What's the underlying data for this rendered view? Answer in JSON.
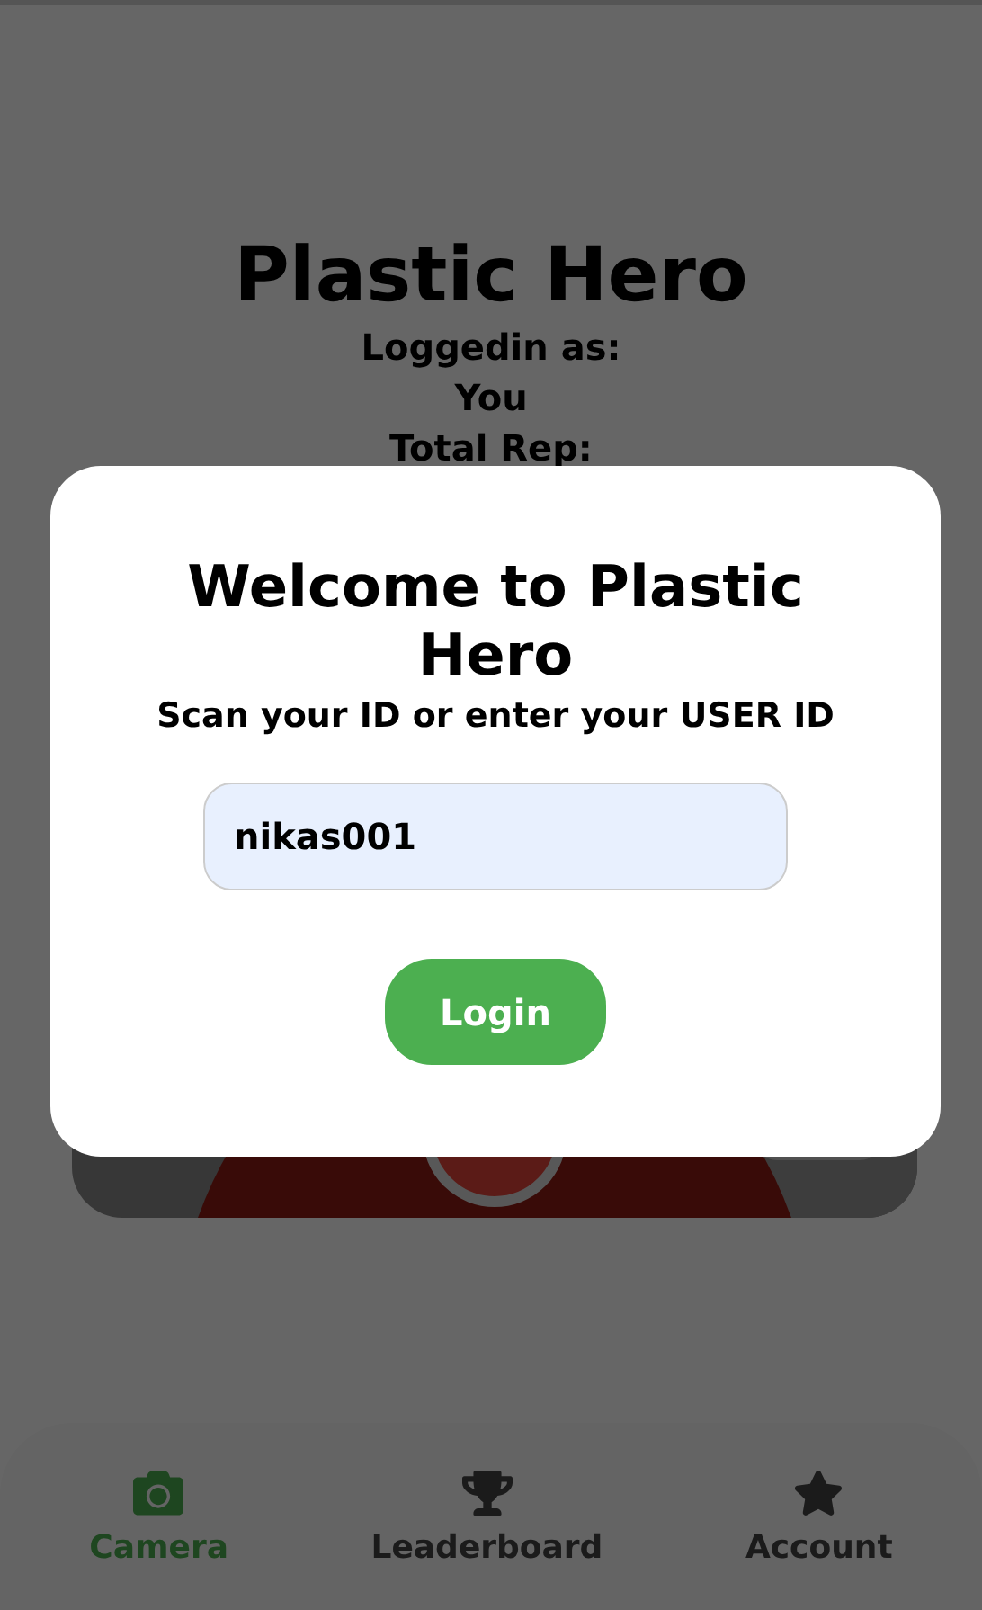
{
  "header": {
    "title": "Plastic Hero",
    "lines": [
      "Loggedin as:",
      "You",
      "Total Rep:"
    ]
  },
  "dialog": {
    "title": "Welcome to Plastic Hero",
    "subtitle": "Scan your ID or enter your USER ID",
    "user_id": {
      "value": "nikas001"
    },
    "button": "Login"
  },
  "nav": [
    {
      "label": "Camera",
      "selected": true
    },
    {
      "label": "Leaderboard",
      "selected": false
    },
    {
      "label": "Account",
      "selected": false
    }
  ]
}
